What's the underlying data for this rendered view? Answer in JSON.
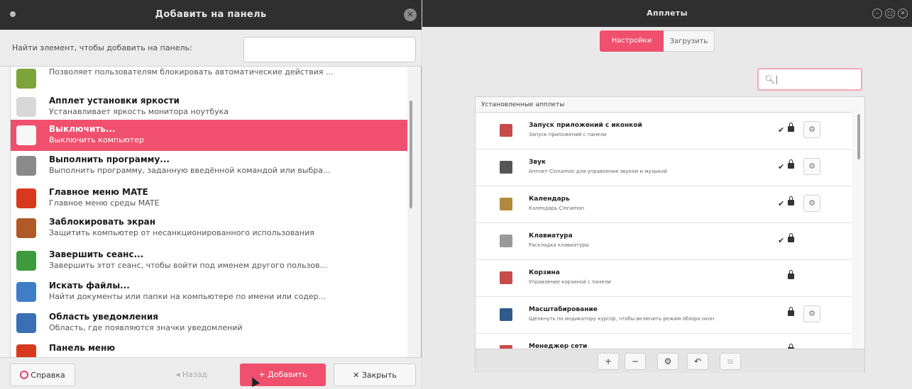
{
  "left_window": {
    "title": "Добавить на панель",
    "search_label": "Найти элемент, чтобы добавить на панель:",
    "search_value": "",
    "applets": [
      {
        "name": "",
        "desc": "Позволяет пользователям блокировать автоматические действия ...",
        "icon": "inhibit-icon",
        "color": "#7da33b"
      },
      {
        "name": "Апплет установки яркости",
        "desc": "Устанавливает яркость монитора ноутбука",
        "icon": "brightness-icon",
        "color": "#d8d8d8"
      },
      {
        "name": "Выключить...",
        "desc": "Выключить компьютер",
        "icon": "shutdown-icon",
        "color": "#f7f7f7"
      },
      {
        "name": "Выполнить программу...",
        "desc": "Выполнить программу, заданную введённой командой или выбра...",
        "icon": "run-program-icon",
        "color": "#8a8a8a"
      },
      {
        "name": "Главное меню MATE",
        "desc": "Главное меню среды MATE",
        "icon": "mate-menu-icon",
        "color": "#d7381e"
      },
      {
        "name": "Заблокировать экран",
        "desc": "Защитить компьютер от несанкционированного использования",
        "icon": "lock-screen-icon",
        "color": "#b05a2a"
      },
      {
        "name": "Завершить сеанс...",
        "desc": "Завершить этот сеанс, чтобы войти под именем другого пользов...",
        "icon": "logout-icon",
        "color": "#3d9a3d"
      },
      {
        "name": "Искать файлы...",
        "desc": "Найти документы или папки на компьютере по имени или содер...",
        "icon": "search-files-icon",
        "color": "#3f7ec7"
      },
      {
        "name": "Область уведомления",
        "desc": "Область, где появляются значки уведомлений",
        "icon": "notification-area-icon",
        "color": "#3a6fb3"
      },
      {
        "name": "Панель меню",
        "desc": "",
        "icon": "menu-bar-icon",
        "color": "#d7381e"
      }
    ],
    "buttons": {
      "help": "Справка",
      "back": "Назад",
      "add": "Добавить",
      "close": "Закрыть"
    }
  },
  "right_window": {
    "title": "Апплеты",
    "tabs": {
      "installed": "Настройки",
      "download": "Загрузить"
    },
    "search_value": "",
    "panel_header": "Установленные апплеты",
    "applets": [
      {
        "name": "Запуск приложений с иконкой",
        "desc": "Запуск приложений с панели",
        "check": "✔",
        "locked": true,
        "configurable": true,
        "icon": "launcher-icon",
        "color": "#c94a4a"
      },
      {
        "name": "Звук",
        "desc": "Апплет Cinnamon для управления звуком и музыкой",
        "check": "✔",
        "locked": true,
        "configurable": true,
        "icon": "sound-icon",
        "color": "#555555"
      },
      {
        "name": "Календарь",
        "desc": "Календарь Cinnamon",
        "check": "✔",
        "locked": true,
        "configurable": true,
        "icon": "calendar-icon",
        "color": "#b08a3a"
      },
      {
        "name": "Клавиатура",
        "desc": "Раскладка клавиатуры",
        "check": "✔",
        "locked": true,
        "configurable": false,
        "icon": "keyboard-icon",
        "color": "#9a9a9a"
      },
      {
        "name": "Корзина",
        "desc": "Управление корзиной с панели",
        "check": "",
        "locked": true,
        "configurable": false,
        "icon": "trash-icon",
        "color": "#c94a4a"
      },
      {
        "name": "Масштабирование",
        "desc": "Щёлкнуть по индикатору курсор, чтобы включить режим обзора окон",
        "check": "",
        "locked": true,
        "configurable": true,
        "icon": "scale-icon",
        "color": "#2f5a8a"
      },
      {
        "name": "Менеджер сети",
        "desc": "",
        "check": "✔",
        "locked": true,
        "configurable": false,
        "icon": "network-icon",
        "color": "#c94a4a"
      }
    ],
    "toolbar": [
      "+",
      "−",
      "⚙",
      "↶",
      "≡"
    ]
  }
}
